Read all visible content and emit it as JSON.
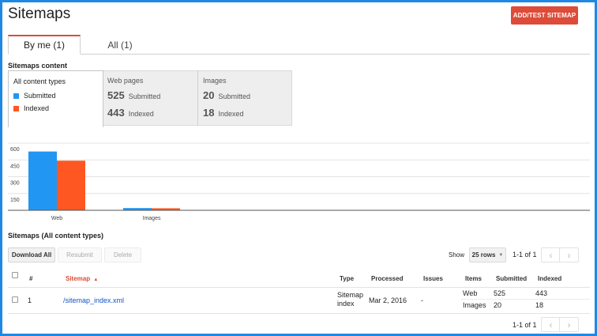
{
  "header": {
    "title": "Sitemaps",
    "add_button": "ADD/TEST SITEMAP"
  },
  "tabs": [
    {
      "label": "By me (1)",
      "active": true
    },
    {
      "label": "All (1)",
      "active": false
    }
  ],
  "content_section": {
    "label": "Sitemaps content",
    "all_types": {
      "label": "All content types",
      "legend": [
        {
          "label": "Submitted",
          "color": "#2196f3"
        },
        {
          "label": "Indexed",
          "color": "#ff5722"
        }
      ]
    },
    "web": {
      "label": "Web pages",
      "submitted": "525",
      "submitted_label": "Submitted",
      "indexed": "443",
      "indexed_label": "Indexed"
    },
    "images": {
      "label": "Images",
      "submitted": "20",
      "submitted_label": "Submitted",
      "indexed": "18",
      "indexed_label": "Indexed"
    }
  },
  "chart_data": {
    "type": "bar",
    "categories": [
      "Web",
      "Images"
    ],
    "series": [
      {
        "name": "Submitted",
        "values": [
          525,
          20
        ],
        "color": "#2196f3"
      },
      {
        "name": "Indexed",
        "values": [
          443,
          18
        ],
        "color": "#ff5722"
      }
    ],
    "yticks": [
      "600",
      "450",
      "300",
      "150"
    ],
    "ylim": [
      0,
      600
    ],
    "grid": true
  },
  "table_section": {
    "label": "Sitemaps (All content types)",
    "buttons": {
      "download": "Download All",
      "resubmit": "Resubmit",
      "delete": "Delete"
    },
    "show_label": "Show",
    "rows_option": "25 rows",
    "range_top": "1-1 of 1",
    "range_bottom": "1-1 of 1",
    "prev_glyph": "‹",
    "next_glyph": "›",
    "sort_glyph": "▲",
    "caret_glyph": "▼",
    "columns": {
      "num": "#",
      "sitemap": "Sitemap",
      "type": "Type",
      "processed": "Processed",
      "issues": "Issues",
      "items": "Items",
      "submitted": "Submitted",
      "indexed": "Indexed"
    },
    "row": {
      "num": "1",
      "sitemap": "/sitemap_index.xml",
      "type_line1": "Sitemap",
      "type_line2": "index",
      "processed": "Mar 2, 2016",
      "issues": "-",
      "items": [
        {
          "item": "Web",
          "submitted": "525",
          "indexed": "443"
        },
        {
          "item": "Images",
          "submitted": "20",
          "indexed": "18"
        }
      ]
    }
  }
}
